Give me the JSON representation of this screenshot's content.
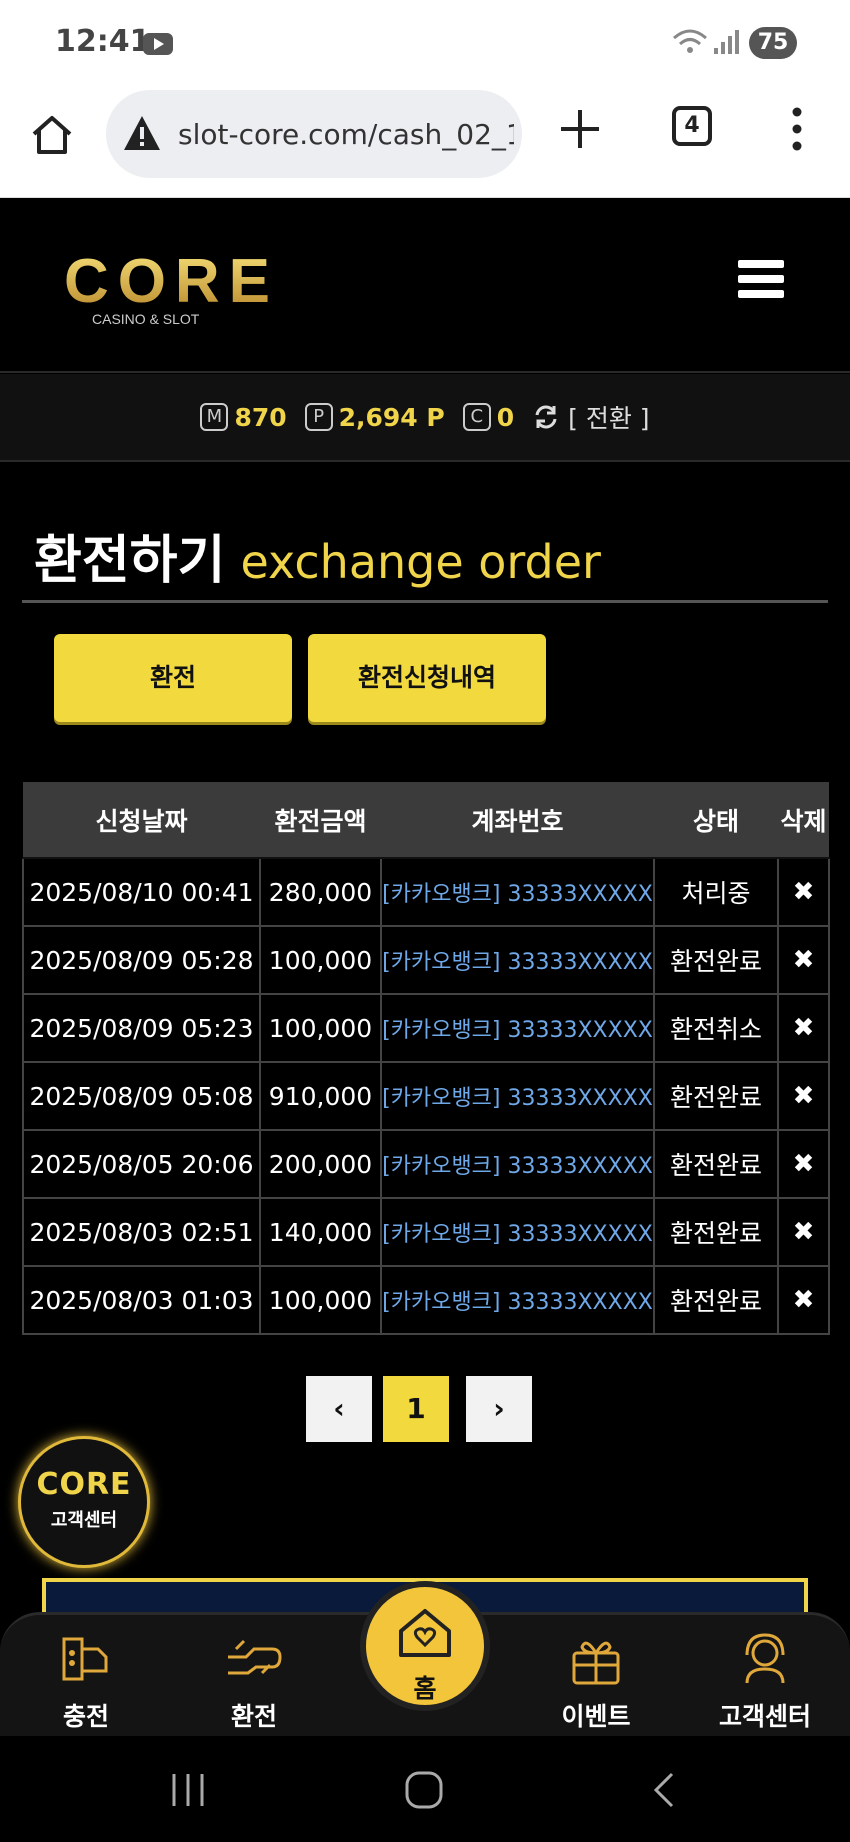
{
  "status_bar": {
    "time": "12:41",
    "battery": "75"
  },
  "browser": {
    "url": "slot-core.com/cash_02_1.",
    "tab_count": "4"
  },
  "site": {
    "logo_text": "CORE",
    "logo_subtext": "CASINO & SLOT"
  },
  "balance": {
    "m_icon": "M",
    "m_value": "870",
    "p_icon": "P",
    "p_value": "2,694 P",
    "c_icon": "C",
    "c_value": "0",
    "switch_label": "[ 전환 ]"
  },
  "page": {
    "title_ko": "환전하기",
    "title_en": "exchange order",
    "btn_exchange": "환전",
    "btn_history": "환전신청내역"
  },
  "table": {
    "headers": [
      "신청날짜",
      "환전금액",
      "계좌번호",
      "상태",
      "삭제"
    ],
    "rows": [
      {
        "date": "2025/08/10 00:41",
        "amount": "280,000",
        "account": "[카카오뱅크] 33333XXXXX",
        "status": "처리중",
        "delete": "✖"
      },
      {
        "date": "2025/08/09 05:28",
        "amount": "100,000",
        "account": "[카카오뱅크] 33333XXXXX",
        "status": "환전완료",
        "delete": "✖"
      },
      {
        "date": "2025/08/09 05:23",
        "amount": "100,000",
        "account": "[카카오뱅크] 33333XXXXX",
        "status": "환전취소",
        "delete": "✖"
      },
      {
        "date": "2025/08/09 05:08",
        "amount": "910,000",
        "account": "[카카오뱅크] 33333XXXXX",
        "status": "환전완료",
        "delete": "✖"
      },
      {
        "date": "2025/08/05 20:06",
        "amount": "200,000",
        "account": "[카카오뱅크] 33333XXXXX",
        "status": "환전완료",
        "delete": "✖"
      },
      {
        "date": "2025/08/03 02:51",
        "amount": "140,000",
        "account": "[카카오뱅크] 33333XXXXX",
        "status": "환전완료",
        "delete": "✖"
      },
      {
        "date": "2025/08/03 01:03",
        "amount": "100,000",
        "account": "[카카오뱅크] 33333XXXXX",
        "status": "환전완료",
        "delete": "✖"
      }
    ]
  },
  "pagination": {
    "prev": "‹",
    "current": "1",
    "next": "›"
  },
  "customer_center": {
    "logo": "CORE",
    "label": "고객센터"
  },
  "bottom_nav": {
    "charge": "충전",
    "exchange": "환전",
    "home": "홈",
    "event": "이벤트",
    "support": "고객센터"
  },
  "colors": {
    "accent": "#f2d93e",
    "link": "#6fa8e8",
    "background": "#000000"
  }
}
